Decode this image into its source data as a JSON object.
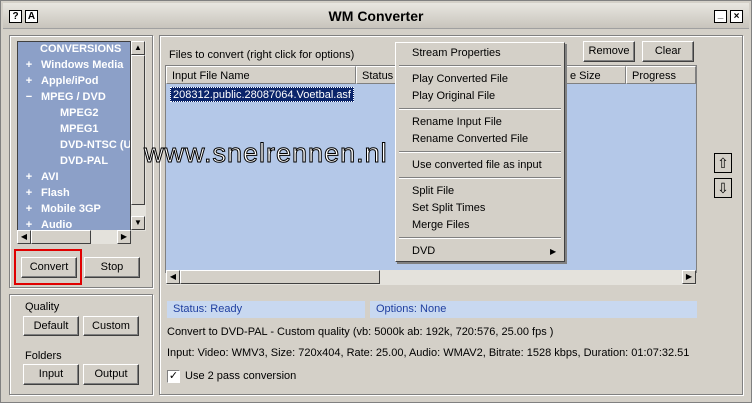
{
  "window": {
    "title": "WM Converter",
    "help_glyph": "?",
    "about_glyph": "A",
    "minimize_glyph": "_",
    "close_glyph": "×"
  },
  "tree": {
    "items": [
      {
        "label": "CONVERSIONS",
        "expander": ""
      },
      {
        "label": "Windows Media",
        "expander": "+"
      },
      {
        "label": "Apple/iPod",
        "expander": "+"
      },
      {
        "label": "MPEG / DVD",
        "expander": "−"
      },
      {
        "label": "MPEG2",
        "expander": ""
      },
      {
        "label": "MPEG1",
        "expander": ""
      },
      {
        "label": "DVD-NTSC (U",
        "expander": ""
      },
      {
        "label": "DVD-PAL",
        "expander": ""
      },
      {
        "label": "AVI",
        "expander": "+"
      },
      {
        "label": "Flash",
        "expander": "+"
      },
      {
        "label": "Mobile 3GP",
        "expander": "+"
      },
      {
        "label": "Audio",
        "expander": "+"
      }
    ]
  },
  "actions": {
    "convert": "Convert",
    "stop": "Stop"
  },
  "quality": {
    "label": "Quality",
    "default": "Default",
    "custom": "Custom"
  },
  "folders": {
    "label": "Folders",
    "input": "Input",
    "output": "Output"
  },
  "files": {
    "caption": "Files to convert (right click for options)",
    "remove": "Remove",
    "clear": "Clear",
    "columns": [
      "Input File Name",
      "Status",
      "e Size",
      "Progress"
    ],
    "rows": [
      {
        "name": "208312.public.28087064.Voetbal.asf"
      }
    ]
  },
  "context_menu": {
    "items": [
      "Stream Properties",
      "Play Converted File",
      "Play Original File",
      "Rename Input File",
      "Rename Converted File",
      "Use converted file as input",
      "Split File",
      "Set Split Times",
      "Merge Files",
      "DVD"
    ],
    "submenu_glyph": "▶"
  },
  "status": {
    "state": "Status: Ready",
    "options": "Options: None"
  },
  "info": {
    "convert_to": "Convert to DVD-PAL - Custom quality (vb: 5000k ab: 192k, 720:576, 25.00 fps )",
    "input": "Input: Video: WMV3, Size: 720x404, Rate: 25.00, Audio: WMAV2, Bitrate: 1528 kbps, Duration: 01:07:32.51"
  },
  "two_pass": {
    "label": "Use 2 pass conversion",
    "checked": true
  },
  "reorder": {
    "up": "⇧",
    "down": "⇩"
  },
  "watermark": "www.snelrennen.nl",
  "colors": {
    "tree_bg": "#8ca0c8",
    "list_bg": "#b4c8e8",
    "highlight": "#e00000",
    "status_text": "#1f3fa0"
  }
}
